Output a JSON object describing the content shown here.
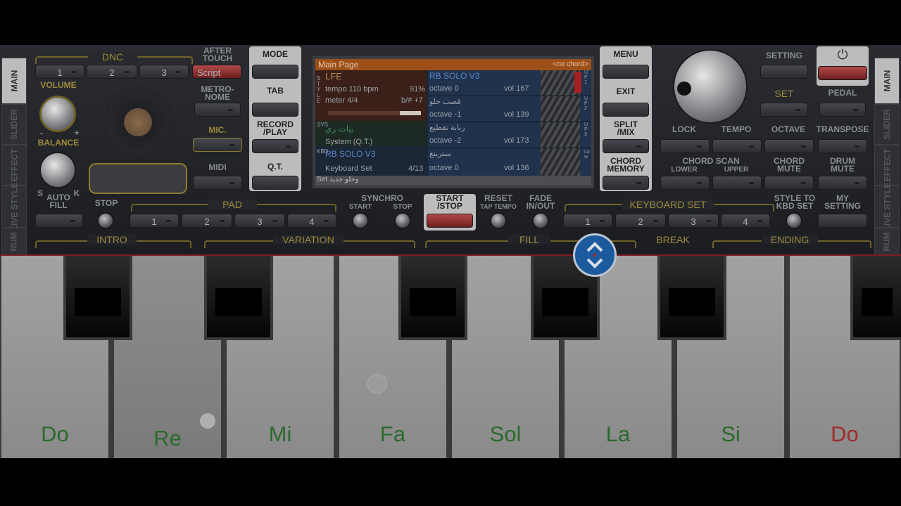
{
  "side_tabs_left": [
    "MAIN",
    "SLIDER",
    "EFFECT",
    "LIVE STYLE",
    "RUM"
  ],
  "side_tabs_right": [
    "MAIN",
    "SLIDER",
    "EFFECT",
    "LIVE STYLE",
    "RUM"
  ],
  "left_panel": {
    "dnc_label": "DNC",
    "dnc_buttons": [
      "1",
      "2",
      "3",
      "Script"
    ],
    "after_touch": "AFTER\nTOUCH",
    "volume": "VOLUME",
    "balance": "BALANCE",
    "balance_minus": "-",
    "balance_plus": "+",
    "s_label": "S",
    "k_label": "K",
    "metronome": "METRO-\nNOME",
    "mic": "MIC.",
    "midi": "MIDI",
    "auto_fill": "AUTO\nFILL",
    "stop": "STOP",
    "pad": "PAD",
    "pad_buttons": [
      "1",
      "2",
      "3",
      "4"
    ]
  },
  "center_left": {
    "mode": "MODE",
    "tab": "TAB",
    "record_play": "RECORD\n/PLAY",
    "qt": "Q.T."
  },
  "screen": {
    "title": "Main Page",
    "chord": "<no chord>",
    "style_name": "LFE",
    "tempo": "tempo 110 bpm",
    "tempo_pct": "91%",
    "meter": "meter 4/4",
    "transpose": "b/# +7",
    "system_name": "بيات ري",
    "system_label": "System (Q.T.)",
    "kbd_name": "RB SOLO V3",
    "kbd_label": "Keyboard Set",
    "kbd_count": "4/13",
    "set_name": "Set وحلو جديد",
    "side_style": "STYLE",
    "side_sys": "SYS",
    "side_kbd": "KBD",
    "parts": [
      {
        "name": "RB SOLO V3",
        "octave": "octave 0",
        "vol": "vol 167",
        "tag": "UP1"
      },
      {
        "name": "قصب حلو",
        "octave": "octave -1",
        "vol": "vol 139",
        "tag": "UP2"
      },
      {
        "name": "ربابة تقطيع",
        "octave": "octave -2",
        "vol": "vol 173",
        "tag": "UP3"
      },
      {
        "name": "سترينغ",
        "octave": "octave 0",
        "vol": "vol 136",
        "tag": "Low"
      }
    ]
  },
  "center_right": {
    "menu": "MENU",
    "exit": "EXIT",
    "split_mix": "SPLIT\n/MIX",
    "chord_memory": "CHORD\nMEMORY"
  },
  "right_panel": {
    "setting": "SETTING",
    "set": "SET",
    "pedal": "PEDAL",
    "lock": "LOCK",
    "tempo": "TEMPO",
    "octave": "OCTAVE",
    "transpose": "TRANSPOSE",
    "chord_scan": "CHORD SCAN",
    "lower": "LOWER",
    "upper": "UPPER",
    "chord_mute": "CHORD\nMUTE",
    "drum_mute": "DRUM\nMUTE",
    "keyboard_set": "KEYBOARD SET",
    "kbd_buttons": [
      "1",
      "2",
      "3",
      "4"
    ],
    "style_to_kbd": "STYLE TO\nKBD SET",
    "my_setting": "MY\nSETTING"
  },
  "transport": {
    "synchro": "SYNCHRO",
    "start": "START",
    "stop": "STOP",
    "start_stop": "START\n/STOP",
    "reset": "RESET",
    "tap_tempo": "TAP TEMPO",
    "fade": "FADE\nIN/OUT"
  },
  "sections": {
    "intro": "INTRO",
    "variation": "VARIATION",
    "fill": "FILL",
    "break": "BREAK",
    "ending": "ENDING"
  },
  "keyboard": {
    "white_keys": [
      "Do",
      "Re",
      "Mi",
      "Fa",
      "Sol",
      "La",
      "Si",
      "Do"
    ],
    "note_color": "#2c6a2d",
    "last_note_color": "#a32a2a"
  },
  "icons": {
    "power": "power-icon",
    "resize": "resize-arrows-icon"
  }
}
